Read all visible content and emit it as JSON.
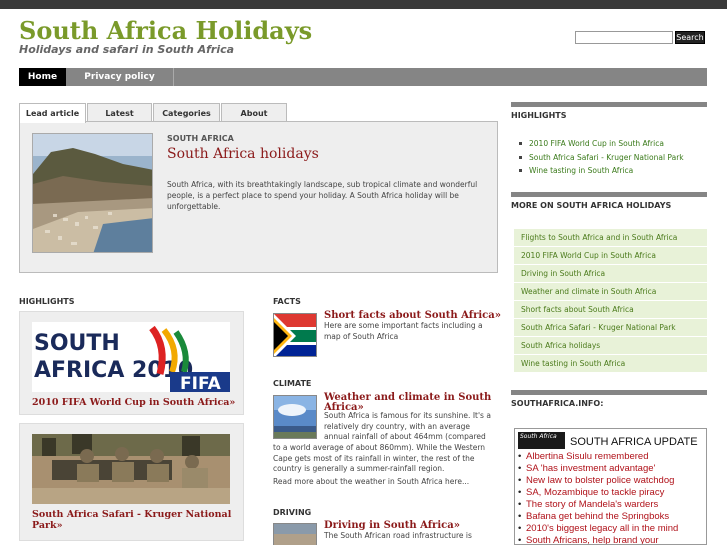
{
  "site": {
    "title": "South Africa Holidays",
    "tagline": "Holidays and safari in South Africa",
    "search_button": "Search",
    "search_value": ""
  },
  "nav": {
    "home": "Home",
    "privacy": "Privacy policy"
  },
  "tabs": [
    "Lead article",
    "Latest",
    "Categories",
    "About"
  ],
  "lead": {
    "section": "SOUTH AFRICA",
    "title": "South Africa holidays",
    "text": "South Africa, with its breathtakingly landscape, sub tropical climate and wonderful people, is a perfect place to spend your holiday. A South Africa holiday will be unforgettable."
  },
  "highlights": {
    "heading": "HIGHLIGHTS",
    "items": [
      {
        "caption": "2010 FIFA World Cup in South Africa»",
        "logo_line1": "SOUTH",
        "logo_line2": "AFRICA 2010",
        "logo_fifa": "FIFA"
      },
      {
        "caption": "South Africa Safari - Kruger National Park»"
      }
    ]
  },
  "articles": [
    {
      "heading": "FACTS",
      "title": "Short facts about South Africa»",
      "text": "Here are some important facts including a map of South Africa"
    },
    {
      "heading": "CLIMATE",
      "title": "Weather and climate in South Africa»",
      "text_right": "South Africa is famous for its sunshine. It's a relatively dry country, with an average annual rainfall of about 464mm (compared",
      "text_full": "to a world average of about 860mm). While the Western Cape gets most of its rainfall in winter, the rest of the country is generally a summer-rainfall region.",
      "more": "Read more about the weather in South Africa here..."
    },
    {
      "heading": "DRIVING",
      "title": "Driving in South Africa»",
      "text": "The South African road infrastructure is"
    }
  ],
  "sidebar": {
    "highlights_heading": "HIGHLIGHTS",
    "highlights": [
      "2010 FIFA World Cup in South Africa",
      "South Africa Safari - Kruger National Park",
      "Wine tasting in South Africa"
    ],
    "more_heading": "MORE ON SOUTH AFRICA HOLIDAYS",
    "more": [
      "Flights to South Africa and in South Africa",
      "2010 FIFA World Cup in South Africa",
      "Driving in South Africa",
      "Weather and climate in South Africa",
      "Short facts about South Africa",
      "South Africa Safari - Kruger National Park",
      "South Africa holidays",
      "Wine tasting in South Africa"
    ],
    "info_heading": "SOUTHAFRICA.INFO:",
    "update_logo": "South Africa",
    "update_title": "SOUTH AFRICA UPDATE",
    "updates": [
      "Albertina Sisulu remembered",
      "SA 'has investment advantage'",
      "New law to bolster police watchdog",
      "SA, Mozambique to tackle piracy",
      "The story of Mandela's warders",
      "Bafana get behind the Springboks",
      "2010's biggest legacy all in the mind",
      "South Africans, help brand your"
    ]
  },
  "colors": {
    "site_title": "#7a9a2a",
    "link_red": "#8b1a1a",
    "link_green": "#4a7a1a",
    "nav_bar": "#858585",
    "update_red": "#b0121a"
  }
}
